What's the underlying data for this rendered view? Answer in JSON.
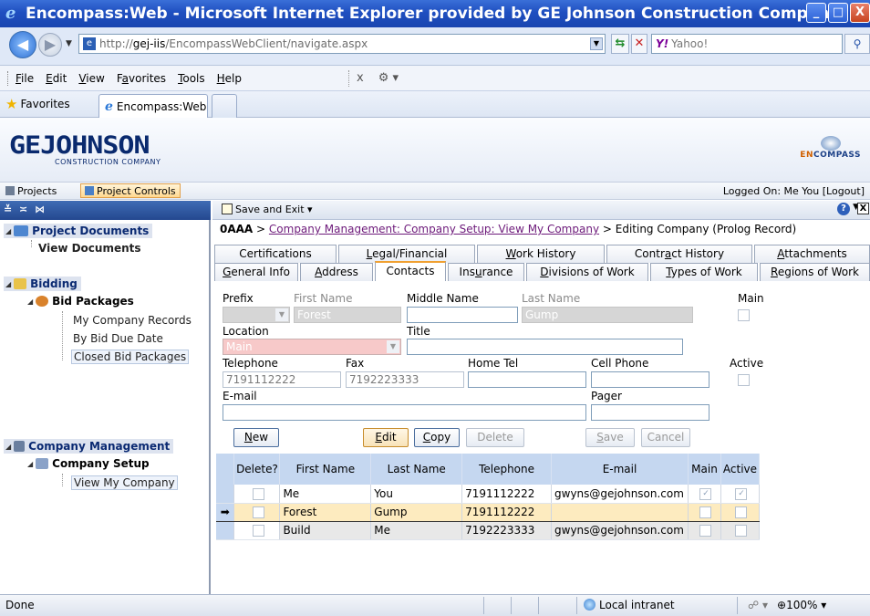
{
  "window": {
    "title": "Encompass:Web - Microsoft Internet Explorer provided by GE Johnson Construction Company",
    "buttons": [
      "_",
      "□",
      "X"
    ]
  },
  "address_bar": {
    "url_prefix": "http://",
    "url_host": "gej-iis",
    "url_path": "/EncompassWebClient/navigate.aspx",
    "search_provider": "Y!",
    "search_placeholder": "Yahoo!"
  },
  "menu": {
    "items": [
      {
        "label_u": "F",
        "label_rest": "ile"
      },
      {
        "label_u": "E",
        "label_rest": "dit"
      },
      {
        "label_u": "V",
        "label_rest": "iew"
      },
      {
        "label_pre": "F",
        "label_u": "a",
        "label_rest": "vorites"
      },
      {
        "label_u": "T",
        "label_rest": "ools"
      },
      {
        "label_u": "H",
        "label_rest": "elp"
      }
    ],
    "x_glyph": "x"
  },
  "favorites_bar": {
    "favorites_label": "Favorites",
    "tab_label": "Encompass:Web"
  },
  "banner": {
    "logo_text": "GEJOHNSON",
    "logo_sub": "CONSTRUCTION COMPANY",
    "brand_en": "EN",
    "brand_rest": "COMPASS"
  },
  "app_nav": {
    "projects": "Projects",
    "project_controls": "Project Controls",
    "logged_on": "Logged On: Me You  [Logout]"
  },
  "left_header": "≚ ≍ ⋈",
  "tree": {
    "project_documents": "Project Documents",
    "view_documents": "View Documents",
    "bidding": "Bidding",
    "bid_packages": "Bid Packages",
    "bid_children": [
      "My Company Records",
      "By Bid Due Date",
      "Closed Bid Packages"
    ],
    "company_management": "Company Management",
    "company_setup": "Company Setup",
    "view_my_company": "View My Company"
  },
  "toolbar": {
    "save_and_exit": "Save and Exit"
  },
  "breadcrumb": {
    "code": "0AAA",
    "sep1": " > ",
    "link": "Company Management: Company Setup: View My Company",
    "sep2": " > ",
    "current": "Editing Company (Prolog Record)"
  },
  "tabs_row1": [
    {
      "pre": "Certifications",
      "u": "",
      "post": ""
    },
    {
      "pre": "",
      "u": "L",
      "post": "egal/Financial"
    },
    {
      "pre": "",
      "u": "W",
      "post": "ork History"
    },
    {
      "pre": "Contr",
      "u": "a",
      "post": "ct History"
    },
    {
      "pre": "",
      "u": "A",
      "post": "ttachments"
    }
  ],
  "tabs_row2": [
    {
      "pre": "",
      "u": "G",
      "post": "eneral Info"
    },
    {
      "pre": "",
      "u": "A",
      "post": "ddress"
    },
    {
      "pre": "Contacts",
      "u": "",
      "post": ""
    },
    {
      "pre": "Ins",
      "u": "u",
      "post": "rance"
    },
    {
      "pre": "",
      "u": "D",
      "post": "ivisions of Work"
    },
    {
      "pre": "",
      "u": "T",
      "post": "ypes of Work"
    },
    {
      "pre": "",
      "u": "R",
      "post": "egions of Work"
    }
  ],
  "form": {
    "prefix_label": "Prefix",
    "first_name_label": "First Name",
    "first_name_value": "Forest",
    "middle_name_label": "Middle Name",
    "last_name_label": "Last Name",
    "last_name_value": "Gump",
    "main_label": "Main",
    "location_label": "Location",
    "location_value": "Main",
    "title_label": "Title",
    "telephone_label": "Telephone",
    "telephone_value": "7191112222",
    "fax_label": "Fax",
    "fax_value": "7192223333",
    "home_tel_label": "Home Tel",
    "cell_phone_label": "Cell Phone",
    "active_label": "Active",
    "email_label": "E-mail",
    "pager_label": "Pager"
  },
  "buttons": {
    "new_u": "N",
    "new_rest": "ew",
    "edit_u": "E",
    "edit_rest": "dit",
    "copy_u": "C",
    "copy_rest": "opy",
    "delete": "Delete",
    "save_u": "S",
    "save_rest": "ave",
    "cancel": "Cancel"
  },
  "grid": {
    "headers": [
      "Delete?",
      "First Name",
      "Last Name",
      "Telephone",
      "E-mail",
      "Main",
      "Active"
    ],
    "rows": [
      {
        "first": "Me",
        "last": "You",
        "tel": "7191112222",
        "email": "gwyns@gejohnson.com",
        "main": true,
        "active": true
      },
      {
        "first": "Forest",
        "last": "Gump",
        "tel": "7191112222",
        "email": "",
        "main": false,
        "active": false
      },
      {
        "first": "Build",
        "last": "Me",
        "tel": "7192223333",
        "email": "gwyns@gejohnson.com",
        "main": false,
        "active": false
      }
    ],
    "current_marker": "➡"
  },
  "status": {
    "done": "Done",
    "zone": "Local intranet",
    "zoom": "100%"
  }
}
